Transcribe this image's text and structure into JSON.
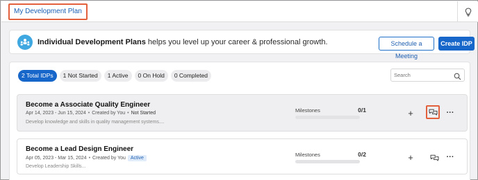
{
  "topbar": {
    "breadcrumb": "My Development Plan",
    "help_icon": "lightbulb-icon"
  },
  "hero": {
    "icon": "people-icon",
    "title_bold": "Individual Development Plans",
    "title_rest": " helps you level up your career & professional growth.",
    "schedule_label": "Schedule a Meeting",
    "create_label": "Create IDP"
  },
  "filters": [
    {
      "label": "2 Total IDPs",
      "active": true
    },
    {
      "label": "1 Not Started",
      "active": false
    },
    {
      "label": "1 Active",
      "active": false
    },
    {
      "label": "0 On Hold",
      "active": false
    },
    {
      "label": "0 Completed",
      "active": false
    }
  ],
  "search": {
    "placeholder": "Search",
    "icon": "search-icon"
  },
  "colors": {
    "primary": "#1766c9",
    "highlight": "#e2603b",
    "badge_bg": "#e1ecfa"
  },
  "idps": [
    {
      "title": "Become a Associate Quality Engineer",
      "dates": "Apr 14, 2023 - Jun 15, 2024",
      "created": "Created by You",
      "status": "Not Started",
      "description": "Develop knowledge and skills in quality management systems....",
      "milestones_label": "Milestones",
      "milestones_value": "0/1",
      "progress": 0
    },
    {
      "title": "Become a Lead Design Engineer",
      "dates": "Apr 05, 2023 - Mar 15, 2024",
      "created": "Created by You",
      "status": "Active",
      "description": "Develop Leadership Skills...",
      "milestones_label": "Milestones",
      "milestones_value": "0/2",
      "progress": 0
    }
  ],
  "actions": {
    "add": "+",
    "comment_icon": "comments-icon",
    "more": "···"
  }
}
